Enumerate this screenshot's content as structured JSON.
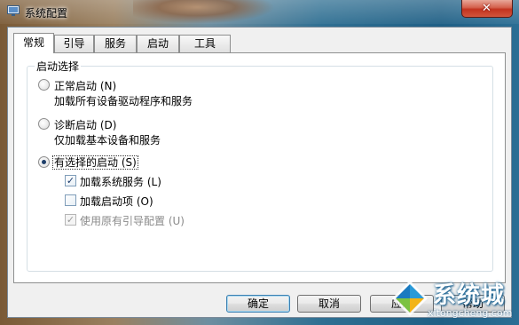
{
  "window": {
    "title": "系统配置"
  },
  "tabs": [
    {
      "label": "常规",
      "active": true
    },
    {
      "label": "引导",
      "active": false
    },
    {
      "label": "服务",
      "active": false
    },
    {
      "label": "启动",
      "active": false
    },
    {
      "label": "工具",
      "active": false
    }
  ],
  "startup_group": {
    "legend": "启动选择",
    "normal": {
      "label": "正常启动",
      "accel": "(N)",
      "desc": "加载所有设备驱动程序和服务",
      "checked": false
    },
    "diagnostic": {
      "label": "诊断启动",
      "accel": "(D)",
      "desc": "仅加载基本设备和服务",
      "checked": false
    },
    "selective": {
      "label": "有选择的启动",
      "accel": "(S)",
      "checked": true
    },
    "options": {
      "load_services": {
        "label": "加载系统服务",
        "accel": "(L)",
        "checked": true,
        "enabled": true
      },
      "load_startup": {
        "label": "加载启动项",
        "accel": "(O)",
        "checked": false,
        "enabled": true
      },
      "use_boot_config": {
        "label": "使用原有引导配置",
        "accel": "(U)",
        "checked": true,
        "enabled": false
      }
    }
  },
  "buttons": {
    "ok": "确定",
    "cancel": "取消",
    "apply": "应用",
    "help": "帮助"
  },
  "watermark": {
    "title": "系统城",
    "url": "xitongcheng.com"
  },
  "icons": {
    "app": "msconfig-icon",
    "close": "close-icon",
    "watermark_logo": "diamond-logo-icon"
  },
  "colors": {
    "close_button": "#c2331f",
    "default_button_border": "#3c7fb1",
    "radio_dot": "#1f3f6a"
  }
}
